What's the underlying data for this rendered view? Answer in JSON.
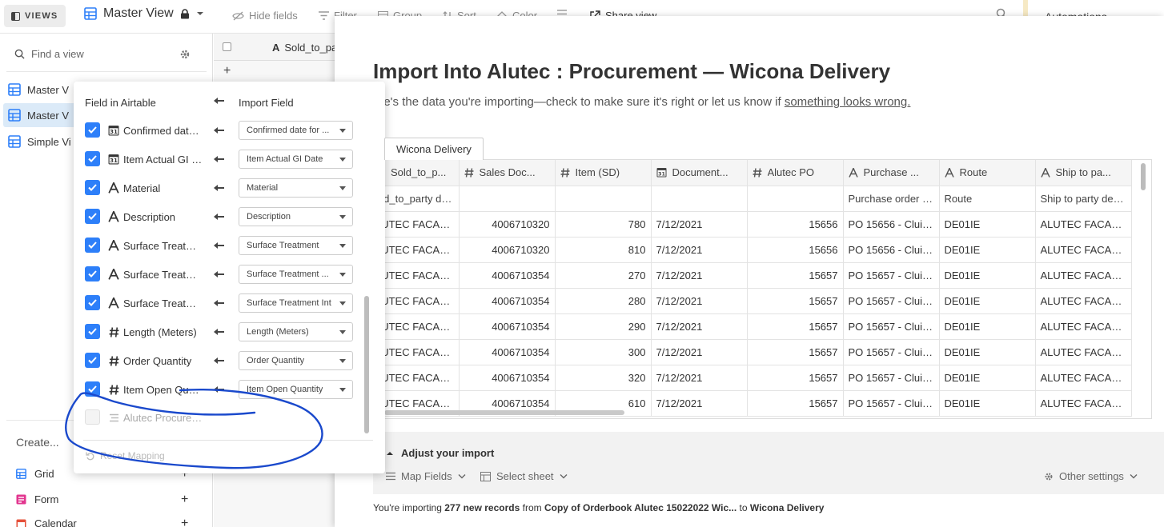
{
  "toolbar": {
    "views_label": "VIEWS",
    "view_title": "Master View",
    "hide_fields": "Hide fields",
    "filter": "Filter",
    "group": "Group",
    "sort": "Sort",
    "color": "Color",
    "share_view": "Share view",
    "automations": "Automations"
  },
  "sidebar": {
    "search_placeholder": "Find a view",
    "views": [
      "Master V",
      "Master V",
      "Simple Vi"
    ],
    "create_label": "Create...",
    "create_items": [
      "Grid",
      "Form",
      "Calendar"
    ]
  },
  "grid": {
    "first_column": "Sold_to_pa"
  },
  "modal": {
    "title": "Import Into Alutec : Procurement — Wicona Delivery",
    "subtitle_prefix": "ere's the data you're importing—check to make sure it's right or let us know if ",
    "subtitle_link": "something looks wrong.",
    "sheet_tab": "Wicona Delivery",
    "columns": [
      "Sold_to_p...",
      "Sales Doc...",
      "Item (SD)",
      "Document...",
      "Alutec PO",
      "Purchase ...",
      "Route",
      "Ship to pa..."
    ],
    "column_types": [
      "text",
      "number",
      "number",
      "date",
      "number",
      "text",
      "text",
      "text"
    ],
    "description_row": [
      "old_to_party de...",
      "",
      "",
      "",
      "",
      "Purchase order n...",
      "Route",
      "Ship to party des..."
    ],
    "rows": [
      [
        "LUTEC FACADE...",
        "4006710320",
        "780",
        "7/12/2021",
        "15656",
        "PO 15656 - Cluid...",
        "DE01IE",
        "ALUTEC FACADE..."
      ],
      [
        "LUTEC FACADE...",
        "4006710320",
        "810",
        "7/12/2021",
        "15656",
        "PO 15656 - Cluid...",
        "DE01IE",
        "ALUTEC FACADE..."
      ],
      [
        "LUTEC FACADE...",
        "4006710354",
        "270",
        "7/12/2021",
        "15657",
        "PO 15657 - Cluid...",
        "DE01IE",
        "ALUTEC FACADE..."
      ],
      [
        "LUTEC FACADE...",
        "4006710354",
        "280",
        "7/12/2021",
        "15657",
        "PO 15657 - Cluid...",
        "DE01IE",
        "ALUTEC FACADE..."
      ],
      [
        "LUTEC FACADE...",
        "4006710354",
        "290",
        "7/12/2021",
        "15657",
        "PO 15657 - Cluid...",
        "DE01IE",
        "ALUTEC FACADE..."
      ],
      [
        "LUTEC FACADE...",
        "4006710354",
        "300",
        "7/12/2021",
        "15657",
        "PO 15657 - Cluid...",
        "DE01IE",
        "ALUTEC FACADE..."
      ],
      [
        "LUTEC FACADE...",
        "4006710354",
        "320",
        "7/12/2021",
        "15657",
        "PO 15657 - Cluid...",
        "DE01IE",
        "ALUTEC FACADE..."
      ],
      [
        "LUTEC FACADE...",
        "4006710354",
        "610",
        "7/12/2021",
        "15657",
        "PO 15657 - Cluid...",
        "DE01IE",
        "ALUTEC FACADE..."
      ]
    ],
    "adjust_title": "Adjust your import",
    "map_fields": "Map Fields",
    "select_sheet": "Select sheet",
    "other_settings": "Other settings",
    "summary": {
      "prefix": "You're importing ",
      "count": "277 new records",
      "middle": " from ",
      "source": "Copy of Orderbook Alutec 15022022 Wic...",
      "to": " to ",
      "target": "Wicona Delivery"
    }
  },
  "mapping": {
    "header_left": "Field in Airtable",
    "header_right": "Import Field",
    "rows": [
      {
        "type": "date",
        "name": "Confirmed date for ...",
        "value": "Confirmed date for ...",
        "checked": true
      },
      {
        "type": "date",
        "name": "Item Actual GI Date",
        "value": "Item Actual GI Date",
        "checked": true
      },
      {
        "type": "text",
        "name": "Material",
        "value": "Material",
        "checked": true
      },
      {
        "type": "text",
        "name": "Description",
        "value": "Description",
        "checked": true
      },
      {
        "type": "text",
        "name": "Surface Treatment",
        "value": "Surface Treatment",
        "checked": true
      },
      {
        "type": "text",
        "name": "Surface Treatment ...",
        "value": "Surface Treatment ...",
        "checked": true
      },
      {
        "type": "text",
        "name": "Surface Treatment Int",
        "value": "Surface Treatment Int",
        "checked": true
      },
      {
        "type": "number",
        "name": "Length (Meters)",
        "value": "Length (Meters)",
        "checked": true
      },
      {
        "type": "number",
        "name": "Order Quantity",
        "value": "Order Quantity",
        "checked": true
      },
      {
        "type": "number",
        "name": "Item Open Quantity",
        "value": "Item Open Quantity",
        "checked": true
      },
      {
        "type": "link",
        "name": "Alutec Procurement",
        "value": "",
        "checked": false
      }
    ],
    "reset_label": "Reset Mapping"
  },
  "colors": {
    "accent_blue": "#2d7ff9",
    "selected_view_bg": "#dbeaf8",
    "annotation_ink": "#1847c8"
  }
}
